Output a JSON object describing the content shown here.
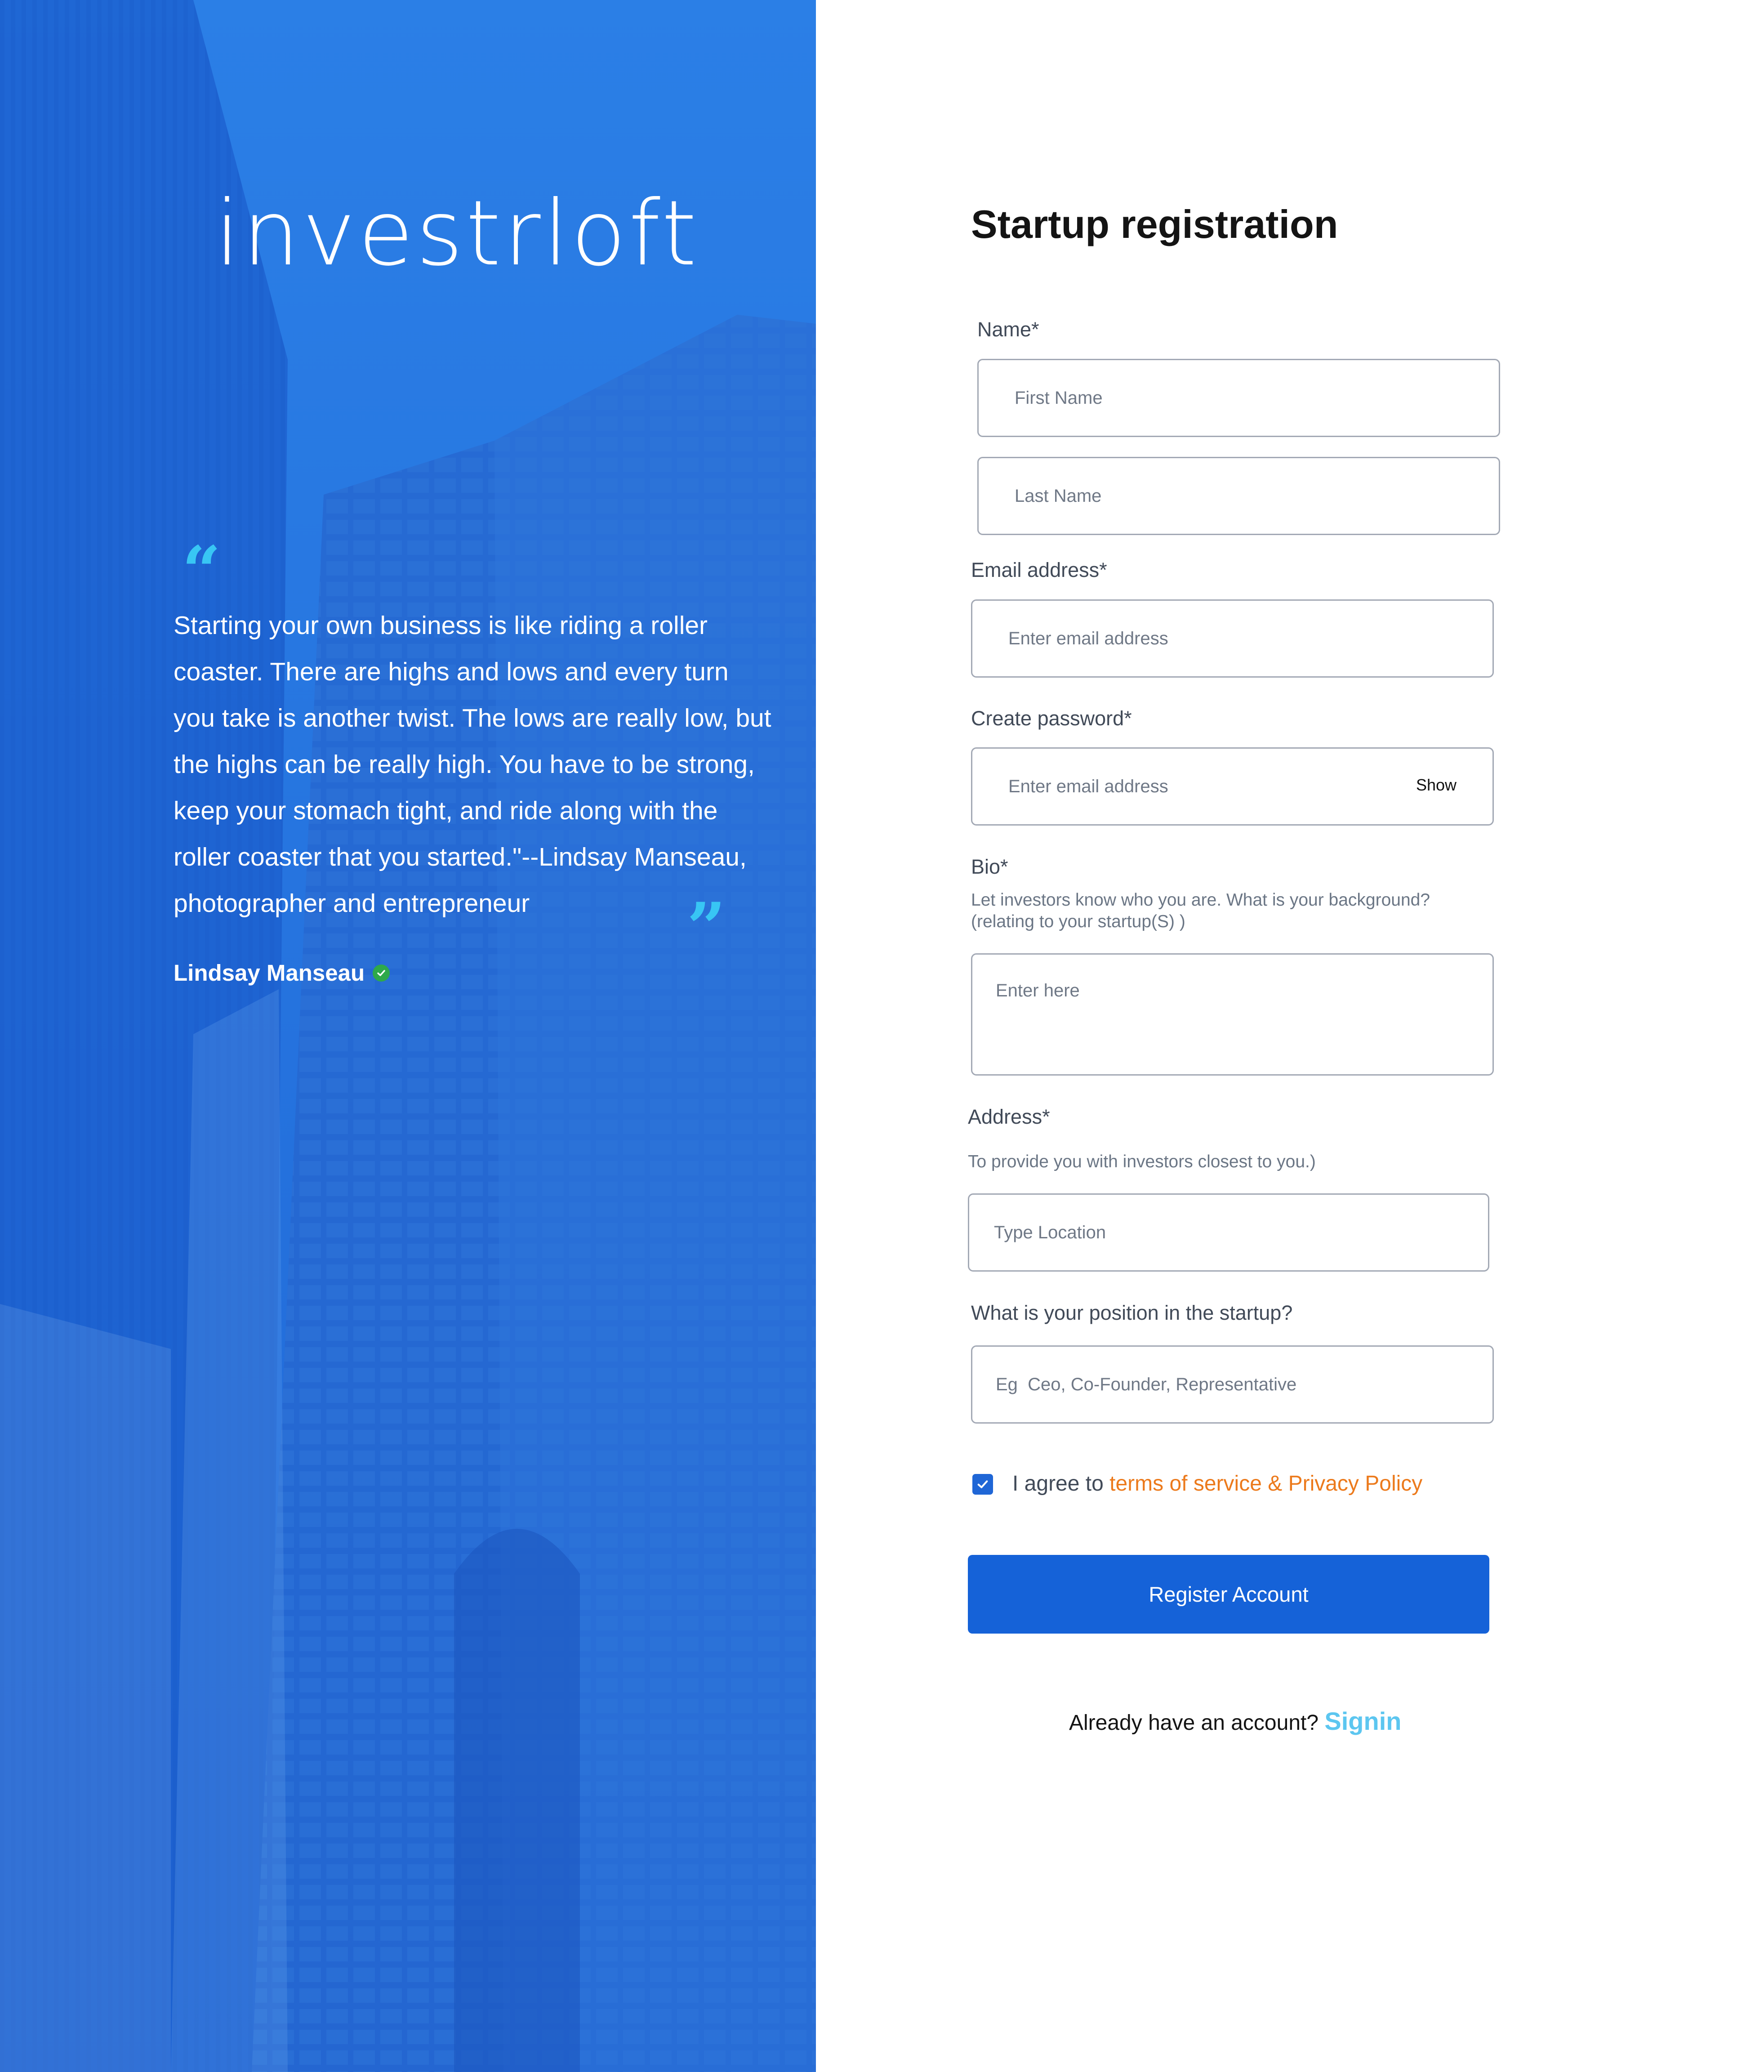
{
  "brand": {
    "logo_text": "investrloft"
  },
  "hero": {
    "quote": "Starting your own business is like riding a roller coaster. There are highs and lows and every turn you take is another twist. The lows are really low, but the highs can be really high. You have to be strong, keep your stomach tight, and ride along with the roller coaster that you started.\"--Lindsay Manseau, photographer and entrepreneur",
    "author": "Lindsay Manseau",
    "open_quote_glyph": "“",
    "close_quote_glyph": "”",
    "verified_icon": "check-circle-icon",
    "accent_color": "#38c6f4"
  },
  "form": {
    "title": "Startup registration",
    "name": {
      "label": "Name*",
      "first_placeholder": "First Name",
      "last_placeholder": "Last Name"
    },
    "email": {
      "label": "Email address*",
      "placeholder": "Enter email address"
    },
    "password": {
      "label": "Create password*",
      "placeholder": "Enter email address",
      "show_label": "Show"
    },
    "bio": {
      "label": "Bio*",
      "hint": "Let investors know who you are. What is your background? (relating to your startup(S) )",
      "placeholder": "Enter here"
    },
    "address": {
      "label": "Address*",
      "hint": "To provide you with investors closest to you.)",
      "placeholder": "Type Location"
    },
    "position": {
      "label": "What is your position in the startup?",
      "placeholder": "Eg  Ceo, Co-Founder, Representative"
    },
    "agree": {
      "checked": true,
      "prefix": "I agree to ",
      "link": "terms of service & Privacy Policy"
    },
    "register_label": "Register Account",
    "signin_prompt": "Already have an account? ",
    "signin_link": "Signin",
    "colors": {
      "primary": "#1562d8",
      "link_orange": "#ec7a1c",
      "signin_blue": "#5cc6f0"
    }
  }
}
